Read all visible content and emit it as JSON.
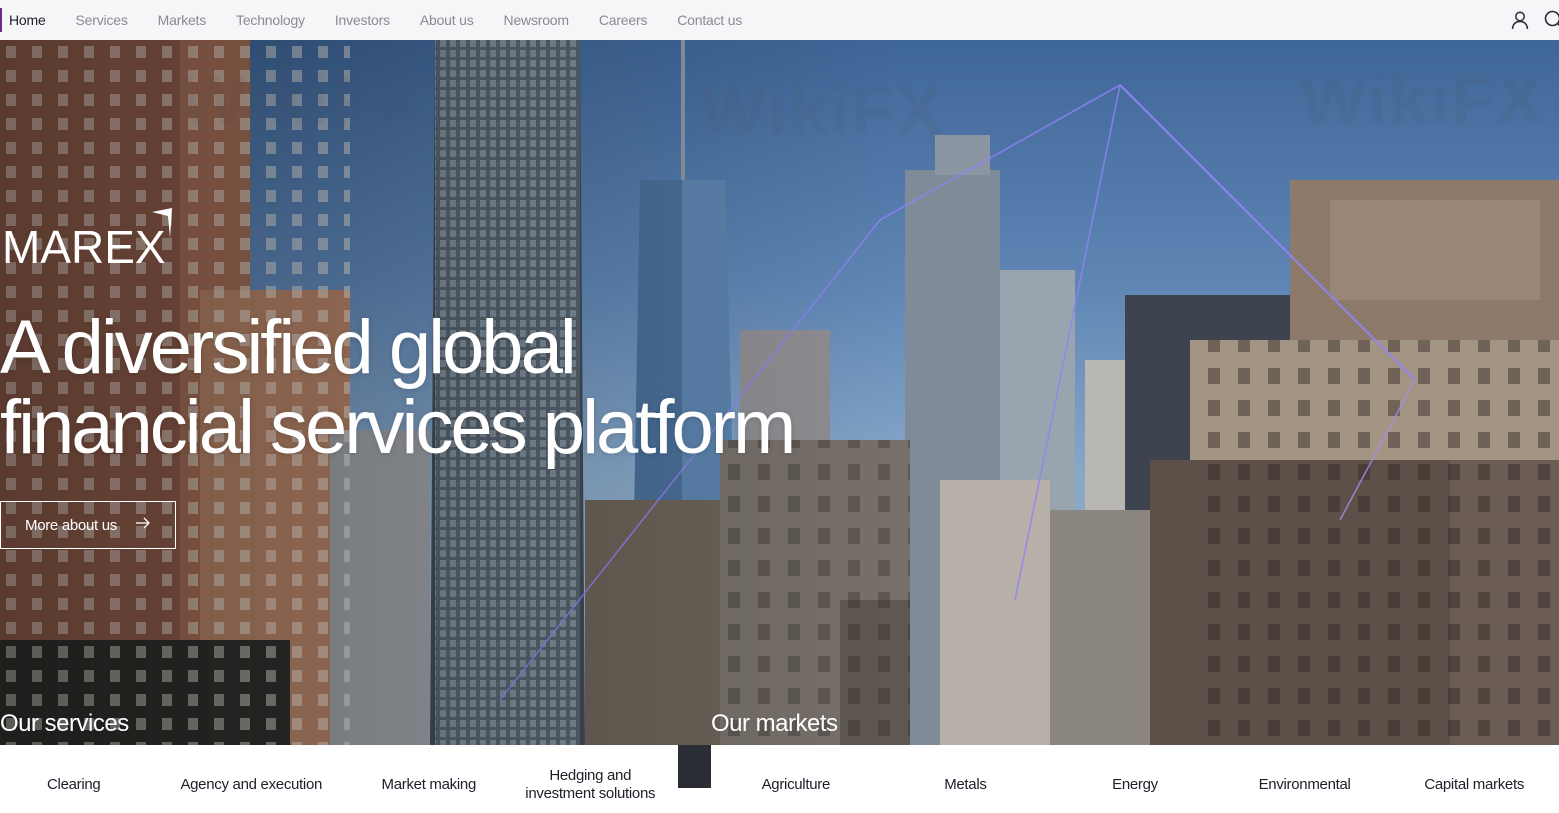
{
  "nav": {
    "items": [
      {
        "label": "Home",
        "active": true
      },
      {
        "label": "Services",
        "active": false
      },
      {
        "label": "Markets",
        "active": false
      },
      {
        "label": "Technology",
        "active": false
      },
      {
        "label": "Investors",
        "active": false
      },
      {
        "label": "About us",
        "active": false
      },
      {
        "label": "Newsroom",
        "active": false
      },
      {
        "label": "Careers",
        "active": false
      },
      {
        "label": "Contact us",
        "active": false
      }
    ],
    "icons": [
      "user-icon",
      "search-icon"
    ]
  },
  "hero": {
    "logo": "MAREX",
    "headline_line1": "A diversified global",
    "headline_line2": "financial services platform",
    "cta_label": "More about us",
    "cta_icon": "arrow-right-icon"
  },
  "services": {
    "title": "Our services",
    "items": [
      "Clearing",
      "Agency and execution",
      "Market making",
      "Hedging and investment solutions"
    ]
  },
  "markets": {
    "title": "Our markets",
    "items": [
      "Agriculture",
      "Metals",
      "Energy",
      "Environmental",
      "Capital markets"
    ]
  },
  "watermark": "WikiFX",
  "colors": {
    "accent": "#6b2a8a",
    "nav_bg": "#f6f6f8",
    "text_dark": "#1f1f2b",
    "nav_text": "#8a8a93",
    "triangle": "#8d83f2"
  }
}
